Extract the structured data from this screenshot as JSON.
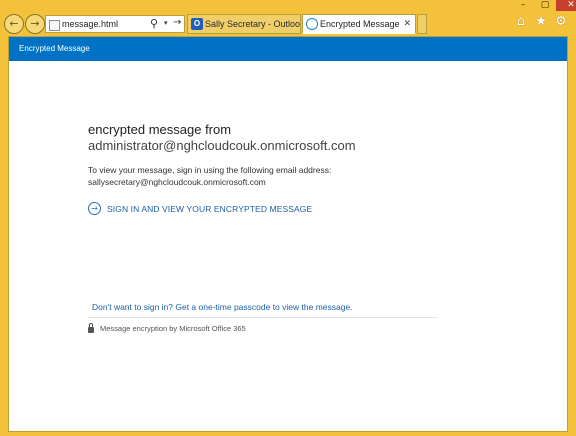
{
  "window": {
    "controls": {
      "minimize": "–",
      "maximize": "▢",
      "close": "✕"
    }
  },
  "browser": {
    "back_icon": "←",
    "forward_icon": "→",
    "address": "message.html",
    "search_icon": "⚲",
    "dropdown_icon": "▾",
    "go_icon": "→",
    "tabs": [
      {
        "label": "Sally Secretary - Outlook Web ...",
        "icon": "O"
      },
      {
        "label": "Encrypted Message",
        "close": "✕"
      }
    ],
    "tools": {
      "home": "⌂",
      "favorites": "★",
      "settings": "⚙"
    }
  },
  "page": {
    "header_title": "Encrypted Message",
    "heading_line1": "encrypted message from",
    "heading_line2": "administrator@nghcloudcouk.onmicrosoft.com",
    "instruction": "To view your message, sign in using the following email address:",
    "email": "sallysecretary@nghcloudcouk.onmicrosoft.com",
    "signin_icon": "→",
    "signin_label": "SIGN IN AND VIEW YOUR ENCRYPTED MESSAGE",
    "passcode_link": "Don't want to sign in? Get a one-time passcode to view the message.",
    "footer_text": "Message encryption by Microsoft Office 365"
  },
  "colors": {
    "frame": "#f3c23a",
    "header_bg": "#0072c6",
    "link": "#1e5fa6"
  }
}
